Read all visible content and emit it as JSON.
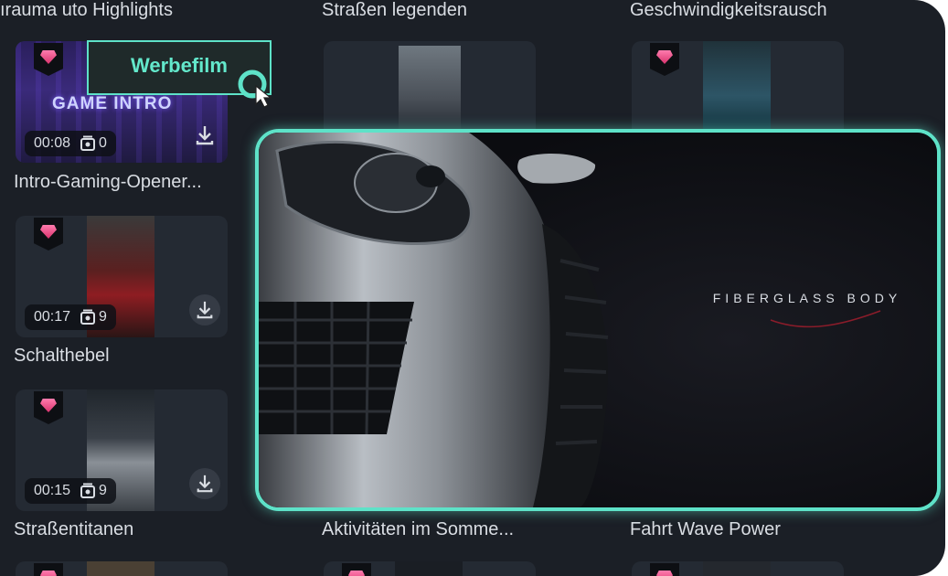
{
  "colors": {
    "accent": "#5ee2c8",
    "panel": "#1b1f26",
    "card": "#242a33",
    "gem": "#e44c82"
  },
  "tooltip": {
    "label": "Werbefilm"
  },
  "top_titles": [
    "ırauma uto Highlights",
    "Straßen legenden",
    "Geschwindigkeitsrausch"
  ],
  "cards": [
    {
      "duration": "00:08",
      "scenes": "0",
      "title": "Intro-Gaming-Opener...",
      "overlay_text": "GAME INTRO"
    },
    {
      "duration": "00:17",
      "scenes": "9",
      "title": "Schalthebel"
    },
    {
      "duration": "00:15",
      "scenes": "9",
      "title": "Straßentitanen"
    }
  ],
  "bottom_titles": [
    "Aktivitäten im Somme...",
    "Fahrt Wave Power"
  ],
  "preview": {
    "caption": "FIBERGLASS BODY"
  }
}
